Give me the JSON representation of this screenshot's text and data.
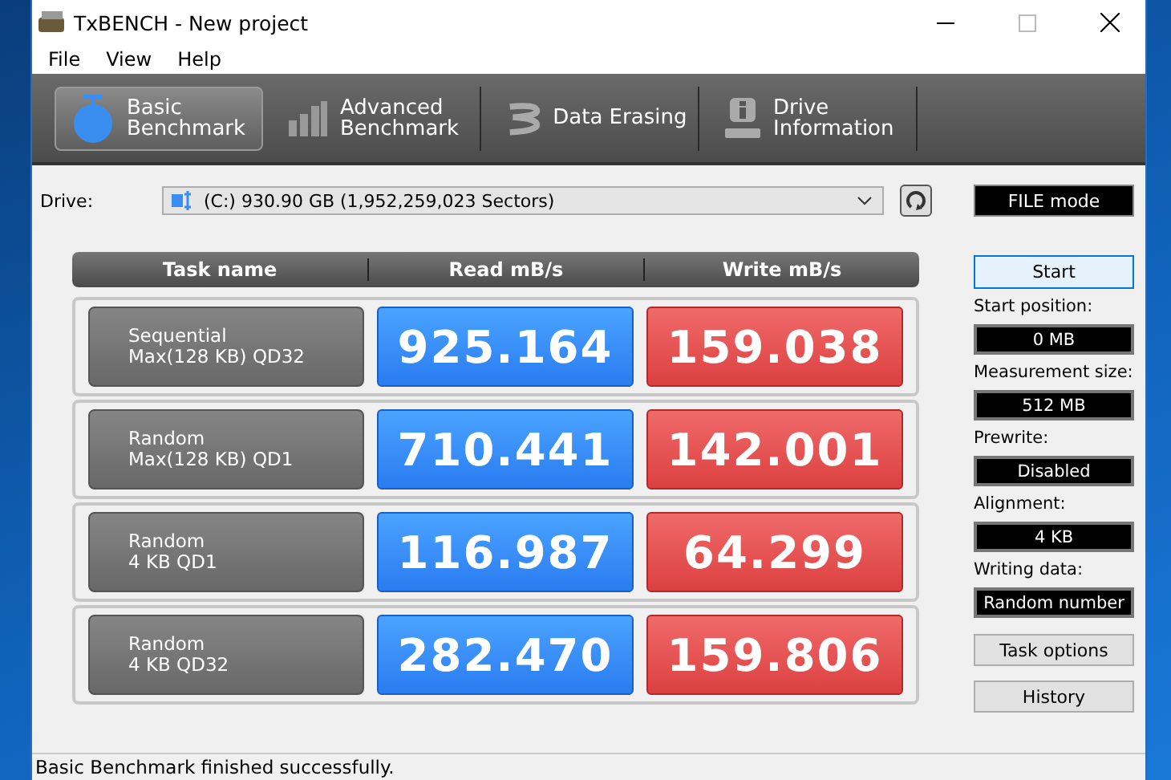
{
  "window": {
    "title": "TxBENCH - New project"
  },
  "menu": [
    "File",
    "View",
    "Help"
  ],
  "tabs": [
    {
      "label": "Basic Benchmark",
      "kind": "timer",
      "selected": true
    },
    {
      "label": "Advanced Benchmark",
      "kind": "bars",
      "selected": false
    },
    {
      "label": "Data Erasing",
      "kind": "erase",
      "selected": false
    },
    {
      "label": "Drive Information",
      "kind": "info",
      "selected": false
    }
  ],
  "drive": {
    "label": "Drive:",
    "value": "(C:)   930.90 GB (1,952,259,023 Sectors)"
  },
  "mode": "FILE mode",
  "table": {
    "columns": [
      "Task name",
      "Read mB/s",
      "Write mB/s"
    ],
    "rows": [
      {
        "name": [
          "Sequential",
          "Max(128 KB) QD32"
        ],
        "read": "925.164",
        "write": "159.038"
      },
      {
        "name": [
          "Random",
          "Max(128 KB) QD1"
        ],
        "read": "710.441",
        "write": "142.001"
      },
      {
        "name": [
          "Random",
          "4 KB QD1"
        ],
        "read": "116.987",
        "write": "64.299"
      },
      {
        "name": [
          "Random",
          "4 KB QD32"
        ],
        "read": "282.470",
        "write": "159.806"
      }
    ]
  },
  "start_button": "Start",
  "settings": [
    {
      "label": "Start position:",
      "value": "0 MB"
    },
    {
      "label": "Measurement size:",
      "value": "512 MB"
    },
    {
      "label": "Prewrite:",
      "value": "Disabled"
    },
    {
      "label": "Alignment:",
      "value": "4 KB"
    },
    {
      "label": "Writing data:",
      "value": "Random number"
    }
  ],
  "buttons": [
    "Task options",
    "History"
  ],
  "status_bar": "Basic Benchmark finished successfully."
}
